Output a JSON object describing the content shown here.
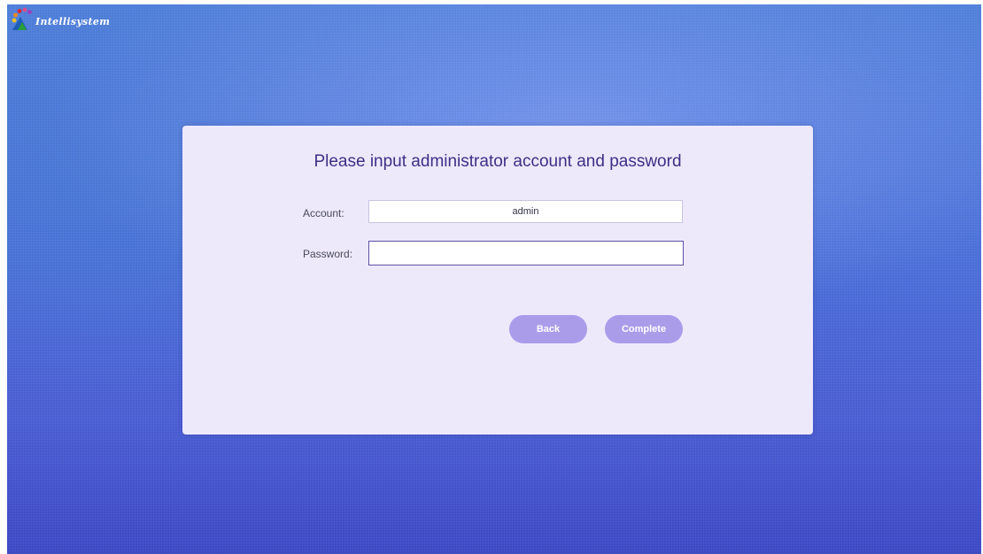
{
  "brand": {
    "logo_text": "Intellisystem"
  },
  "dialog": {
    "title": "Please input administrator account and password",
    "account_label": "Account:",
    "account_value": "admin",
    "password_label": "Password:",
    "password_value": "",
    "back_label": "Back",
    "complete_label": "Complete"
  },
  "colors": {
    "dialog_background": "#ede9fb",
    "title_color": "#3e2f86",
    "button_color": "#ab9cea",
    "focused_border": "#5e4fa3"
  }
}
